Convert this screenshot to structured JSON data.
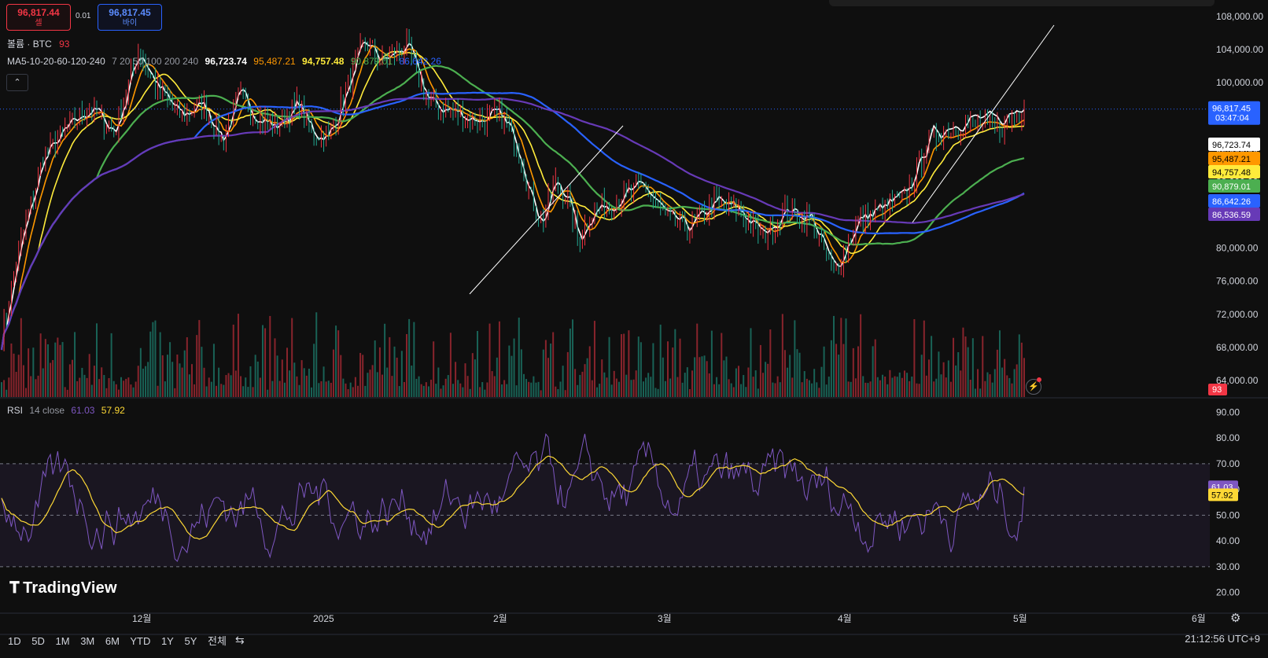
{
  "quote": {
    "sell_price": "96,817.44",
    "sell_label": "셀",
    "spread": "0.01",
    "buy_price": "96,817.45",
    "buy_label": "바이"
  },
  "volume_legend": {
    "label": "볼륨 · BTC",
    "value": "93"
  },
  "ma_legend": {
    "label": "MA5-10-20-60-120-240",
    "params": "7 20 50 100 200 240",
    "values": [
      "96,723.74",
      "95,487.21",
      "94,757.48",
      "90,879.01",
      "86,642.26"
    ]
  },
  "rsi_legend": {
    "label": "RSI",
    "params": "14 close",
    "rsi": "61.03",
    "ma": "57.92"
  },
  "brand": {
    "name": "TradingView"
  },
  "toolbar": {
    "ranges": [
      "1D",
      "5D",
      "1M",
      "3M",
      "6M",
      "YTD",
      "1Y",
      "5Y",
      "전체"
    ]
  },
  "clock": "21:12:56 UTC+9",
  "colors": {
    "up": "#f23645",
    "down": "#22ab94",
    "price_line": "#2962ff",
    "ma1": "#ffffff",
    "ma2": "#ff9800",
    "ma3": "#ffeb3b",
    "ma4": "#4caf50",
    "ma5": "#2962ff",
    "ma6": "#673ab7",
    "rsi": "#7e57c2",
    "rsi_ma": "#fdd835"
  },
  "icons": [
    "chevron-up-icon",
    "calendar-range-icon",
    "settings-icon",
    "flash-icon"
  ],
  "chart_data": [
    {
      "type": "line",
      "title": "BTC price with moving averages",
      "x_labels": [
        "12월",
        "2025",
        "2월",
        "3월",
        "4월",
        "5월",
        "6월"
      ],
      "y_ticks": [
        "108,000.00",
        "104,000.00",
        "100,000.00",
        "96,000.00",
        "92,000.00",
        "88,000.00",
        "84,000.00",
        "80,000.00",
        "76,000.00",
        "72,000.00",
        "68,000.00",
        "64,000.00"
      ],
      "ylim": [
        62000,
        110000
      ],
      "last_price": 96817.45,
      "last_price_label": "96,817.45",
      "countdown": "03:47:04",
      "volume_last_label": "93",
      "key_points": {
        "price": [
          [
            0,
            69000
          ],
          [
            0.03,
            80000
          ],
          [
            0.07,
            91000
          ],
          [
            0.11,
            94500
          ],
          [
            0.15,
            97000
          ],
          [
            0.19,
            94000
          ],
          [
            0.23,
            104000
          ],
          [
            0.26,
            99500
          ],
          [
            0.3,
            96000
          ],
          [
            0.34,
            97500
          ],
          [
            0.37,
            93000
          ],
          [
            0.4,
            98500
          ],
          [
            0.43,
            96000
          ],
          [
            0.46,
            94500
          ],
          [
            0.5,
            97500
          ],
          [
            0.52,
            94000
          ],
          [
            0.55,
            93500
          ],
          [
            0.58,
            99000
          ],
          [
            0.61,
            105000
          ],
          [
            0.64,
            102500
          ],
          [
            0.68,
            104500
          ],
          [
            0.72,
            97500
          ],
          [
            0.76,
            96500
          ],
          [
            0.8,
            95500
          ],
          [
            0.84,
            96000
          ],
          [
            0.87,
            92000
          ],
          [
            0.89,
            86000
          ],
          [
            0.91,
            83000
          ],
          [
            0.93,
            88000
          ],
          [
            0.95,
            86500
          ],
          [
            0.97,
            81000
          ],
          [
            0.99,
            84000
          ]
        ],
        "price2": [
          [
            0,
            84500
          ],
          [
            0.04,
            86000
          ],
          [
            0.08,
            87500
          ],
          [
            0.12,
            83500
          ],
          [
            0.16,
            82500
          ],
          [
            0.2,
            85500
          ],
          [
            0.24,
            84500
          ],
          [
            0.28,
            81500
          ],
          [
            0.32,
            84500
          ],
          [
            0.36,
            83500
          ],
          [
            0.4,
            77000
          ],
          [
            0.44,
            83000
          ],
          [
            0.48,
            84500
          ],
          [
            0.52,
            86000
          ],
          [
            0.56,
            93000
          ],
          [
            0.6,
            94500
          ],
          [
            0.64,
            95000
          ],
          [
            0.68,
            94500
          ],
          [
            0.72,
            96700
          ]
        ]
      },
      "series": [
        {
          "name": "96,723.74",
          "color": "#ffffff",
          "last": 96723.74
        },
        {
          "name": "95,487.21",
          "color": "#ff9800",
          "last": 95487.21
        },
        {
          "name": "94,757.48",
          "color": "#ffeb3b",
          "last": 94757.48
        },
        {
          "name": "90,879.01",
          "color": "#4caf50",
          "last": 90879.01
        },
        {
          "name": "86,642.26",
          "color": "#2962ff",
          "last": 86642.26
        },
        {
          "name": "86,536.59",
          "color": "#673ab7",
          "last": 86536.59
        }
      ]
    },
    {
      "type": "line",
      "title": "RSI 14 close",
      "y_ticks": [
        "90.00",
        "80.00",
        "70.00",
        "60.00",
        "50.00",
        "40.00",
        "30.00",
        "20.00"
      ],
      "ylim": [
        15,
        95
      ],
      "band": [
        30,
        70
      ],
      "series": [
        {
          "name": "61.03",
          "color": "#7e57c2",
          "last": 61.03
        },
        {
          "name": "57.92",
          "color": "#fdd835",
          "last": 57.92
        }
      ]
    }
  ]
}
